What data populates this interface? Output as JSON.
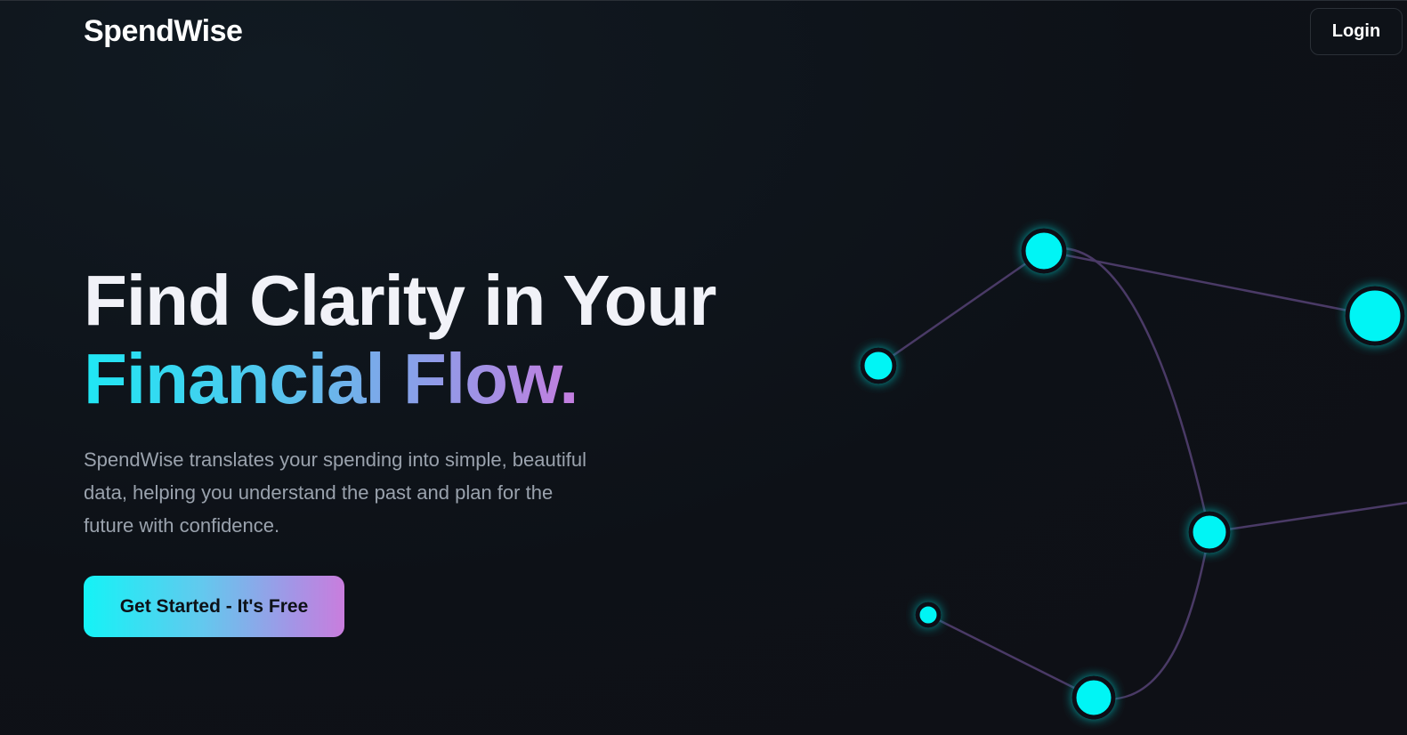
{
  "brand": {
    "name": "SpendWise"
  },
  "nav": {
    "login_label": "Login"
  },
  "hero": {
    "title_line1": "Find Clarity in Your",
    "title_line2": "Financial Flow.",
    "description": "SpendWise translates your spending into simple, beautiful data, helping you understand the past and plan for the future with confidence.",
    "cta_label": "Get Started - It's Free"
  },
  "colors": {
    "background": "#0d1117",
    "node": "#00f5f5",
    "link": "#4a3a66",
    "gradient_start": "#14f3f6",
    "gradient_end": "#c97ddd"
  }
}
